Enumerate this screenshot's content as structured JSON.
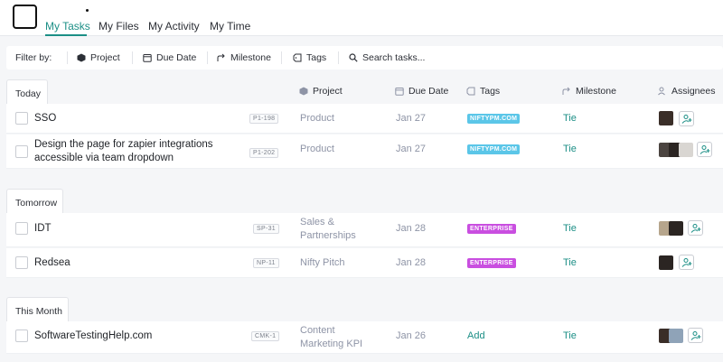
{
  "nav": {
    "tabs": [
      {
        "label": "My Tasks",
        "active": true
      },
      {
        "label": "My Files",
        "active": false
      },
      {
        "label": "My Activity",
        "active": false
      },
      {
        "label": "My Time",
        "active": false
      }
    ]
  },
  "filters": {
    "label": "Filter by:",
    "project": "Project",
    "due_date": "Due Date",
    "milestone": "Milestone",
    "tags": "Tags",
    "search_placeholder": "Search tasks..."
  },
  "columns": {
    "project": "Project",
    "due_date": "Due Date",
    "tags": "Tags",
    "milestone": "Milestone",
    "assignees": "Assignees"
  },
  "groups": [
    {
      "name": "Today",
      "tasks": [
        {
          "title": "SSO",
          "id": "P1-198",
          "project": "Product",
          "due": "Jan 27",
          "tag": "NIFTYPM.COM",
          "milestone": "Tie"
        },
        {
          "title": "Design the page for zapier integrations accessible via team dropdown",
          "id": "P1-202",
          "project": "Product",
          "due": "Jan 27",
          "tag": "NIFTYPM.COM",
          "milestone": "Tie"
        }
      ]
    },
    {
      "name": "Tomorrow",
      "tasks": [
        {
          "title": "IDT",
          "id": "SP-31",
          "project": "Sales & Partnerships",
          "due": "Jan 28",
          "tag": "ENTERPRISE",
          "milestone": "Tie"
        },
        {
          "title": "Redsea",
          "id": "NP-11",
          "project": "Nifty Pitch",
          "due": "Jan 28",
          "tag": "ENTERPRISE",
          "milestone": "Tie"
        }
      ]
    },
    {
      "name": "This Month",
      "tasks": [
        {
          "title": "SoftwareTestingHelp.com",
          "id": "CMK-1",
          "project": "Content Marketing KPI",
          "due": "Jan 26",
          "tag_action": "Add",
          "milestone": "Tie"
        }
      ]
    }
  ],
  "colors": {
    "accent": "#1c8f86",
    "tag_niftypm": "#5bc6e8",
    "tag_enterprise": "#c94ee0"
  }
}
